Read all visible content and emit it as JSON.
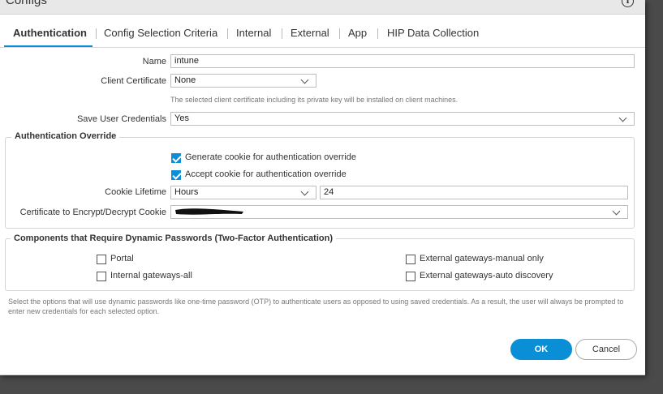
{
  "dialog": {
    "title": "Configs",
    "info_glyph": "i"
  },
  "tabs": [
    {
      "label": "Authentication",
      "active": true
    },
    {
      "label": "Config Selection Criteria"
    },
    {
      "label": "Internal"
    },
    {
      "label": "External"
    },
    {
      "label": "App"
    },
    {
      "label": "HIP Data Collection"
    }
  ],
  "form": {
    "name_label": "Name",
    "name_value": "intune",
    "client_cert_label": "Client Certificate",
    "client_cert_value": "None",
    "client_cert_hint": "The selected client certificate including its private key will be installed on client machines.",
    "save_creds_label": "Save User Credentials",
    "save_creds_value": "Yes"
  },
  "auth_override": {
    "legend": "Authentication Override",
    "generate_cookie_label": "Generate cookie for authentication override",
    "generate_cookie_checked": true,
    "accept_cookie_label": "Accept cookie for authentication override",
    "accept_cookie_checked": true,
    "cookie_lifetime_label": "Cookie Lifetime",
    "cookie_lifetime_unit": "Hours",
    "cookie_lifetime_value": "24",
    "cert_cookie_label": "Certificate to Encrypt/Decrypt Cookie"
  },
  "two_factor": {
    "legend": "Components that Require Dynamic Passwords (Two-Factor Authentication)",
    "options": {
      "portal": "Portal",
      "internal_all": "Internal gateways-all",
      "external_manual": "External gateways-manual only",
      "external_auto": "External gateways-auto discovery"
    }
  },
  "footnote": "Select the options that will use dynamic passwords like one-time password (OTP) to authenticate users as opposed to using saved credentials. As a result, the user will always be prompted to enter new credentials for each selected option.",
  "buttons": {
    "ok": "OK",
    "cancel": "Cancel"
  },
  "colors": {
    "accent": "#0a8fd6"
  }
}
